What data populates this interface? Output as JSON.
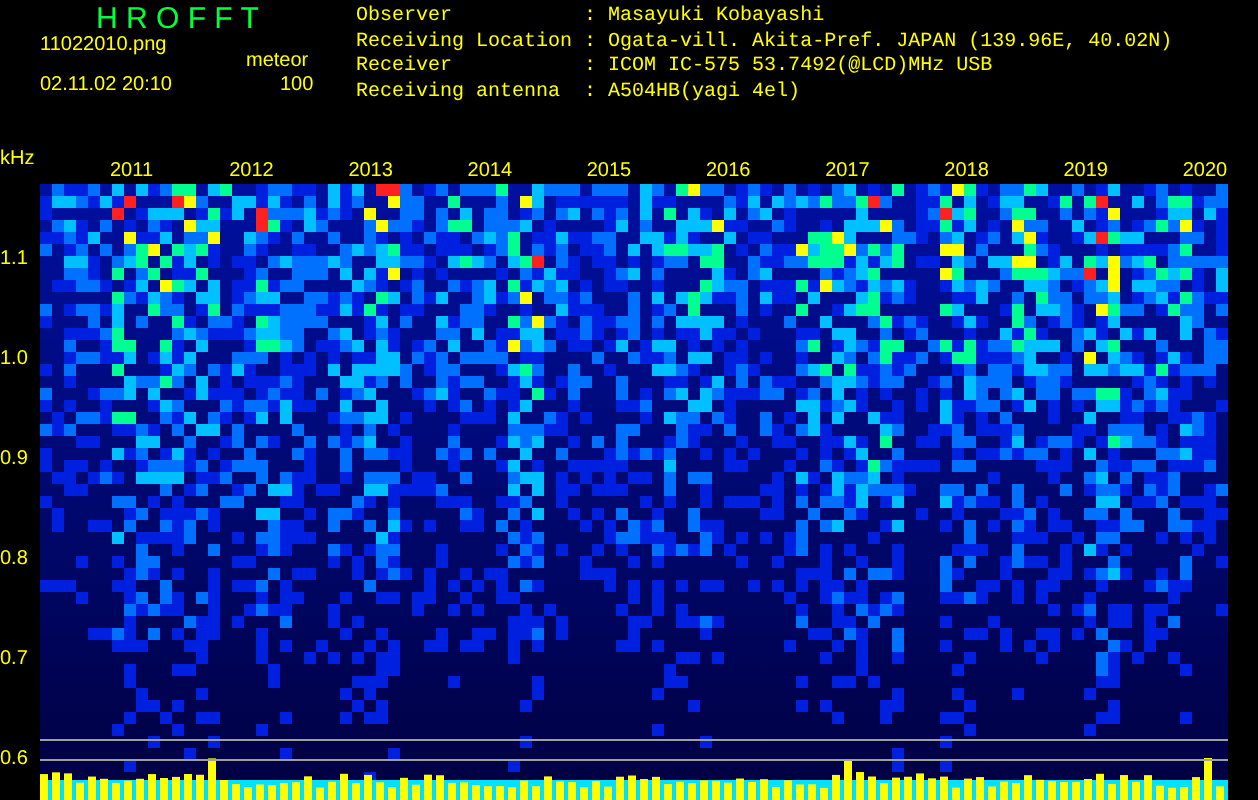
{
  "app_title": "H R O F F T",
  "file_name": "11022010.png",
  "mode": "meteor",
  "datetime": "02.11.02 20:10",
  "count": "100",
  "station_info": [
    {
      "label": "Observer",
      "colon": ":",
      "value": "Masayuki Kobayashi"
    },
    {
      "label": "Receiving Location",
      "colon": ":",
      "value": "Ogata-vill. Akita-Pref. JAPAN (139.96E, 40.02N)"
    },
    {
      "label": "Receiver",
      "colon": ":",
      "value": "ICOM IC-575 53.7492(@LCD)MHz USB"
    },
    {
      "label": "Receiving antenna",
      "colon": ":",
      "value": "A504HB(yagi 4el)"
    }
  ],
  "y_axis": {
    "unit": "kHz",
    "ticks": [
      "1.1",
      "1.0",
      "0.9",
      "0.8",
      "0.7",
      "0.6"
    ]
  },
  "time_labels": [
    "2011",
    "2012",
    "2013",
    "2014",
    "2015",
    "2016",
    "2017",
    "2018",
    "2019",
    "2020"
  ]
}
